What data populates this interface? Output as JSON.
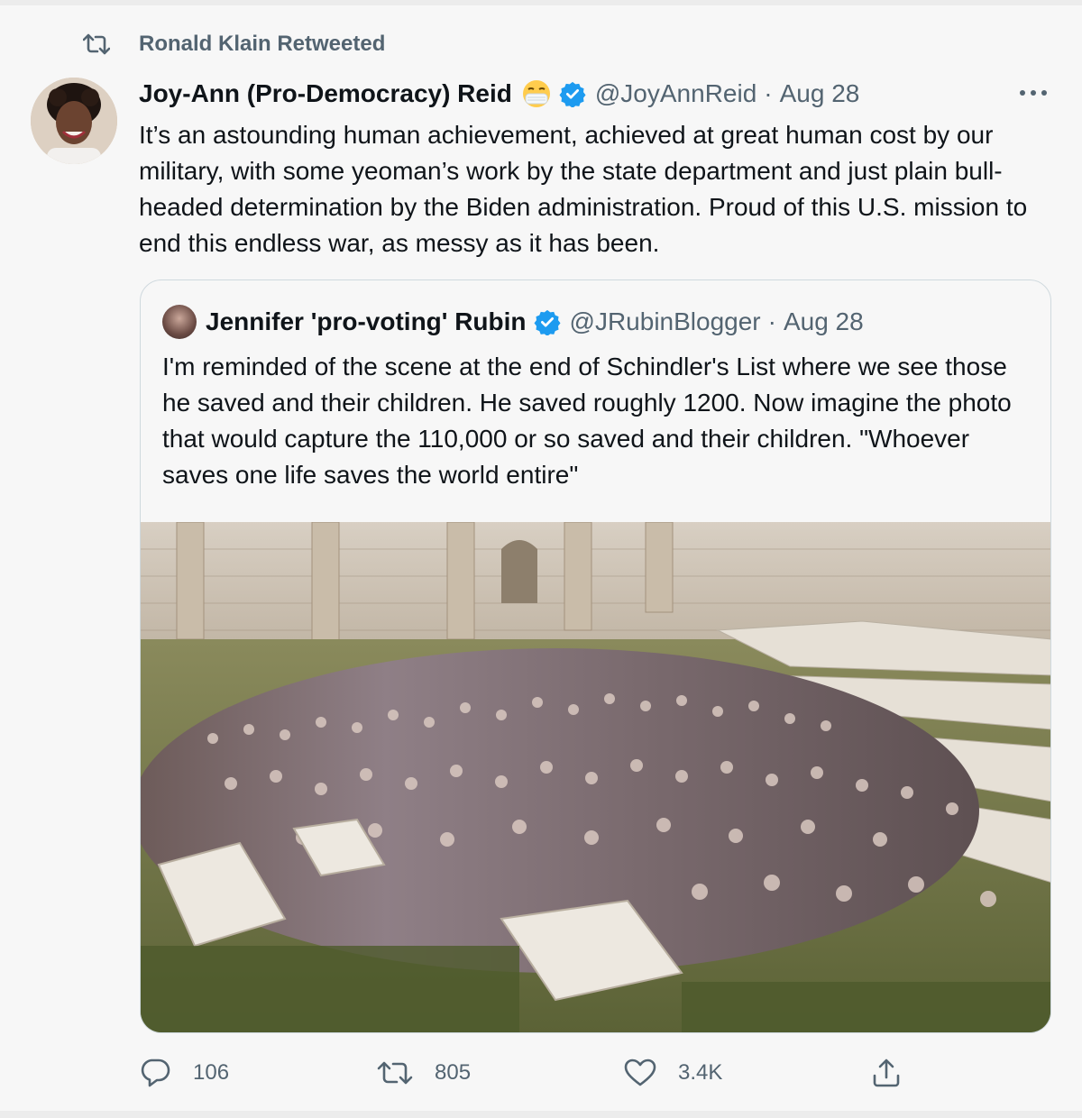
{
  "retweet_context": {
    "label": "Ronald Klain Retweeted"
  },
  "tweet": {
    "author_name": "Joy-Ann (Pro-Democracy) Reid",
    "handle": "@JoyAnnReid",
    "separator": "·",
    "date": "Aug 28",
    "text": "It’s an astounding human achievement, achieved at great human cost by our military, with some yeoman’s work by the state department and just plain bull-headed determination by the Biden administration. Proud of this U.S. mission to end this endless war, as messy as it has been."
  },
  "quoted_tweet": {
    "author_name": "Jennifer 'pro-voting' Rubin",
    "handle": "@JRubinBlogger",
    "separator": "·",
    "date": "Aug 28",
    "text": "I'm reminded of the scene at the end of Schindler's List where we see those he saved and their children. He saved roughly 1200. Now imagine the photo that would capture the 110,000 or so saved and their children. \"Whoever saves one life saves the world entire\""
  },
  "actions": {
    "reply_count": "106",
    "retweet_count": "805",
    "like_count": "3.4K"
  },
  "icons": {
    "retweet": "retweet-icon",
    "more": "more-icon",
    "verified": "verified-badge-icon",
    "emoji": "face-with-medical-mask-emoji",
    "reply": "reply-icon",
    "like": "heart-icon",
    "share": "share-icon"
  },
  "colors": {
    "text_primary": "#0f1419",
    "text_secondary": "#536471",
    "verified_blue": "#1d9bf0",
    "border": "#cfd9de"
  }
}
